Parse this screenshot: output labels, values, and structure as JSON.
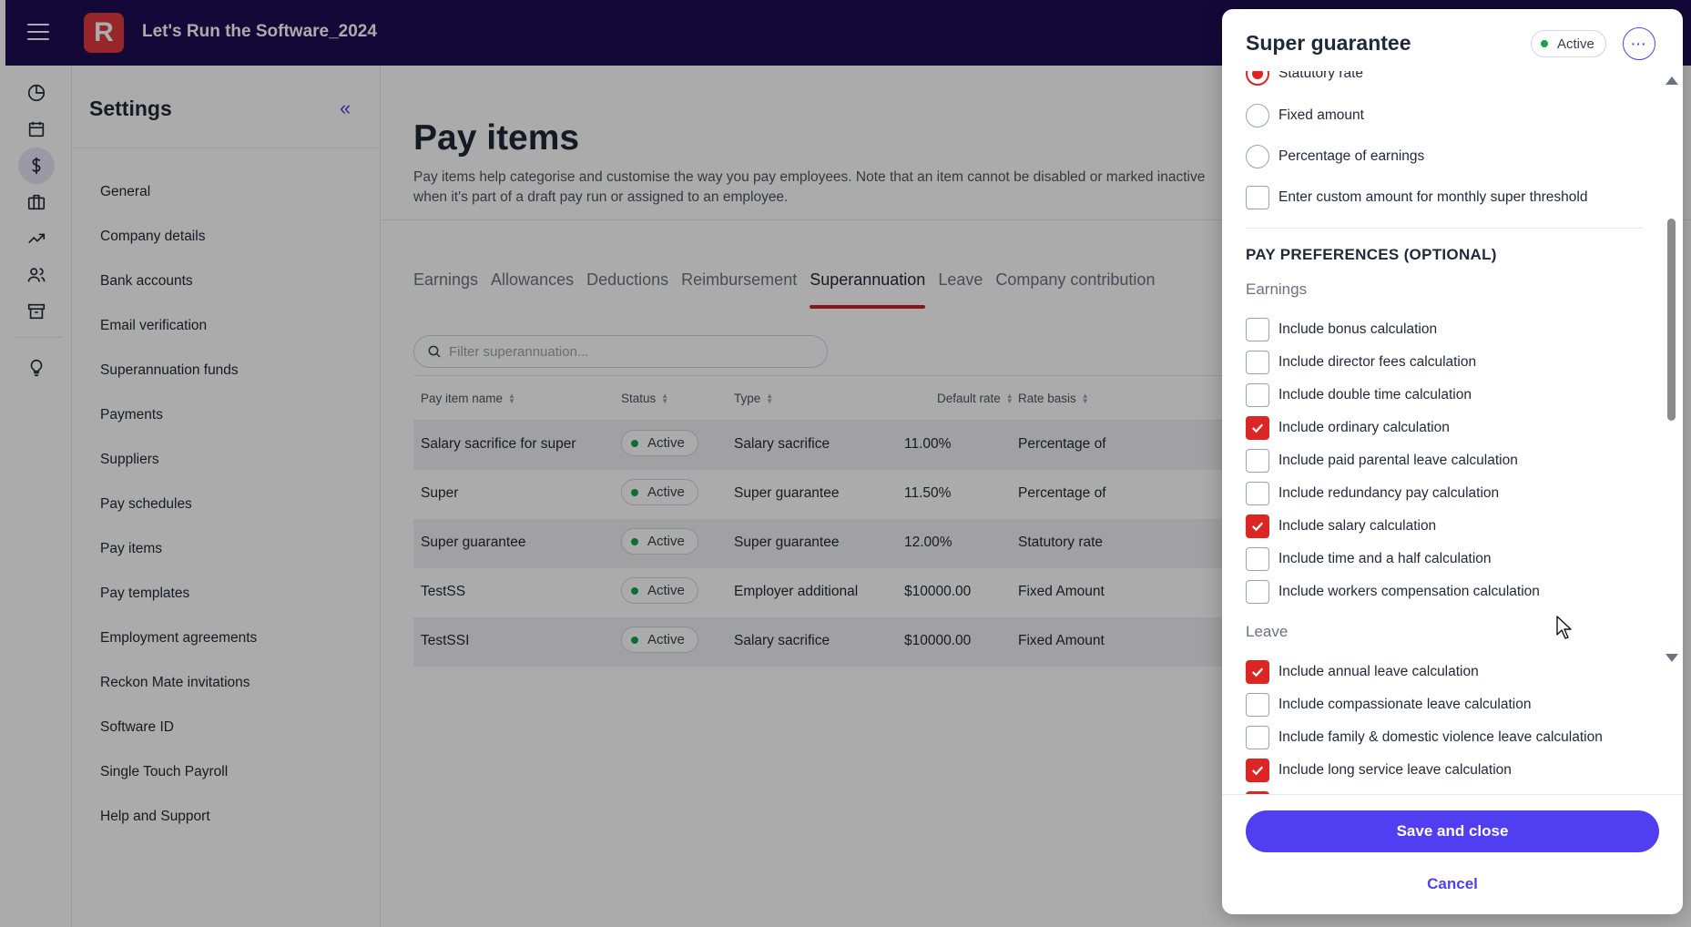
{
  "app": {
    "title": "Let's Run the Software_2024",
    "logo_letter": "R"
  },
  "rail": {
    "icons": [
      "dashboard-icon",
      "calendar-icon",
      "dollar-icon",
      "briefcase-icon",
      "trending-icon",
      "people-icon",
      "archive-icon",
      "lightbulb-icon"
    ],
    "active": "dollar-icon"
  },
  "settings": {
    "title": "Settings",
    "collapse_label": "«",
    "nav": [
      "General",
      "Company details",
      "Bank accounts",
      "Email verification",
      "Superannuation funds",
      "Payments",
      "Suppliers",
      "Pay schedules",
      "Pay items",
      "Pay templates",
      "Employment agreements",
      "Reckon Mate invitations",
      "Software ID",
      "Single Touch Payroll",
      "Help and Support"
    ]
  },
  "main": {
    "title": "Pay items",
    "description": "Pay items help categorise and customise the way you pay employees. Note that an item cannot be disabled or marked inactive when it's part of a draft pay run or assigned to an employee.",
    "tabs": [
      "Earnings",
      "Allowances",
      "Deductions",
      "Reimbursement",
      "Superannuation",
      "Leave",
      "Company contribution"
    ],
    "active_tab": "Superannuation",
    "search_placeholder": "Filter superannuation...",
    "columns": [
      "Pay item name",
      "Status",
      "Type",
      "Default rate",
      "Rate basis"
    ],
    "rows": [
      {
        "name": "Salary sacrifice for super",
        "status": "Active",
        "type": "Salary sacrifice",
        "rate": "11.00%",
        "basis": "Percentage of"
      },
      {
        "name": "Super",
        "status": "Active",
        "type": "Super guarantee",
        "rate": "11.50%",
        "basis": "Percentage of"
      },
      {
        "name": "Super guarantee",
        "status": "Active",
        "type": "Super guarantee",
        "rate": "12.00%",
        "basis": "Statutory rate"
      },
      {
        "name": "TestSS",
        "status": "Active",
        "type": "Employer additional",
        "rate": "$10000.00",
        "basis": "Fixed Amount"
      },
      {
        "name": "TestSSI",
        "status": "Active",
        "type": "Salary sacrifice",
        "rate": "$10000.00",
        "basis": "Fixed Amount"
      }
    ]
  },
  "drawer": {
    "title": "Super guarantee",
    "status": "Active",
    "more_label": "···",
    "rate_options": [
      {
        "label": "Statutory rate",
        "selected": true
      },
      {
        "label": "Fixed amount",
        "selected": false
      },
      {
        "label": "Percentage of earnings",
        "selected": false
      }
    ],
    "custom_threshold": {
      "label": "Enter custom amount for monthly super threshold",
      "checked": false
    },
    "section_title": "PAY PREFERENCES (OPTIONAL)",
    "earnings_label": "Earnings",
    "earnings": [
      {
        "label": "Include bonus calculation",
        "checked": false
      },
      {
        "label": "Include director fees calculation",
        "checked": false
      },
      {
        "label": "Include double time calculation",
        "checked": false
      },
      {
        "label": "Include ordinary calculation",
        "checked": true
      },
      {
        "label": "Include paid parental leave calculation",
        "checked": false
      },
      {
        "label": "Include redundancy pay calculation",
        "checked": false
      },
      {
        "label": "Include salary calculation",
        "checked": true
      },
      {
        "label": "Include time and a half calculation",
        "checked": false
      },
      {
        "label": "Include workers compensation calculation",
        "checked": false
      }
    ],
    "leave_label": "Leave",
    "leave": [
      {
        "label": "Include annual leave calculation",
        "checked": true
      },
      {
        "label": "Include compassionate leave calculation",
        "checked": false
      },
      {
        "label": "Include family & domestic violence leave calculation",
        "checked": false
      },
      {
        "label": "Include long service leave calculation",
        "checked": true
      }
    ],
    "save_label": "Save and close",
    "cancel_label": "Cancel"
  }
}
